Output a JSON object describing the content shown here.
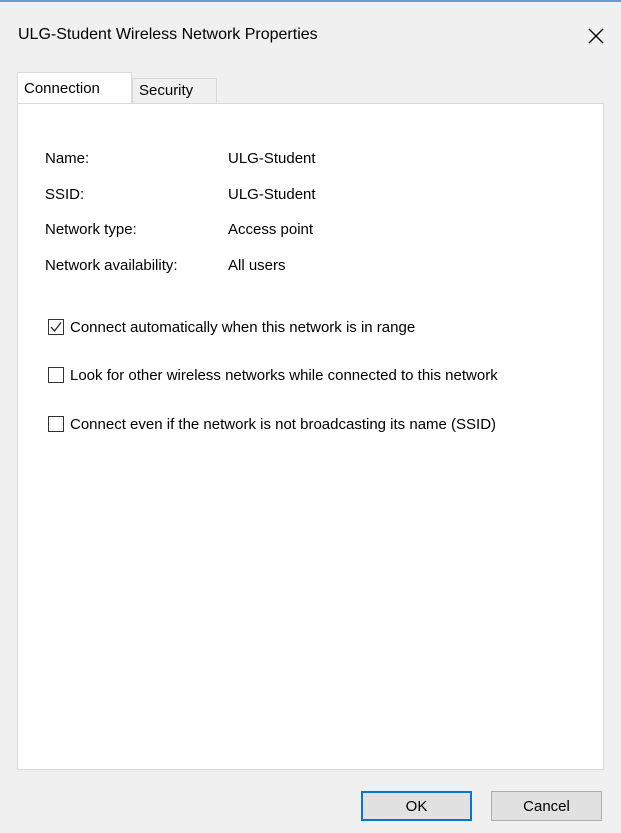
{
  "window": {
    "title": "ULG-Student Wireless Network Properties"
  },
  "tabs": [
    {
      "label": "Connection",
      "active": true
    },
    {
      "label": "Security",
      "active": false
    }
  ],
  "connection": {
    "info": [
      {
        "label": "Name:",
        "value": "ULG-Student"
      },
      {
        "label": "SSID:",
        "value": "ULG-Student"
      },
      {
        "label": "Network type:",
        "value": "Access point"
      },
      {
        "label": "Network availability:",
        "value": "All users"
      }
    ],
    "options": [
      {
        "label": "Connect automatically when this network is in range",
        "checked": true
      },
      {
        "label": "Look for other wireless networks while connected to this network",
        "checked": false
      },
      {
        "label": "Connect even if the network is not broadcasting its name (SSID)",
        "checked": false
      }
    ]
  },
  "buttons": {
    "ok": "OK",
    "cancel": "Cancel"
  },
  "colors": {
    "accent": "#0078d7",
    "background": "#f0f0f0",
    "panel": "#ffffff"
  }
}
